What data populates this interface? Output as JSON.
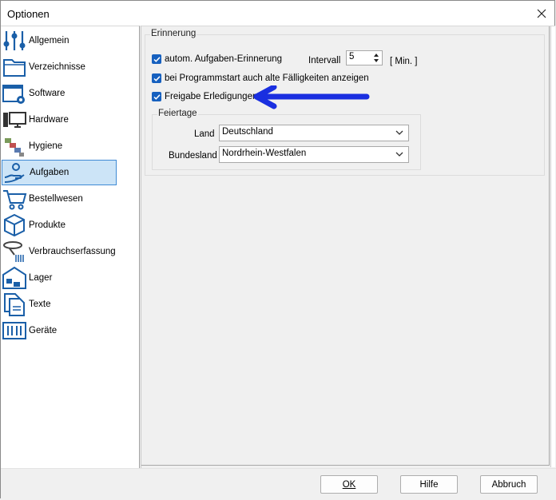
{
  "window": {
    "title": "Optionen"
  },
  "sidebar": {
    "items": [
      {
        "label": "Allgemein",
        "icon": "sliders-icon"
      },
      {
        "label": "Verzeichnisse",
        "icon": "folder-icon"
      },
      {
        "label": "Software",
        "icon": "window-gear-icon"
      },
      {
        "label": "Hardware",
        "icon": "computer-icon"
      },
      {
        "label": "Hygiene",
        "icon": "hygiene-icon"
      },
      {
        "label": "Aufgaben",
        "icon": "task-hand-icon",
        "selected": true
      },
      {
        "label": "Bestellwesen",
        "icon": "cart-icon"
      },
      {
        "label": "Produkte",
        "icon": "box-icon"
      },
      {
        "label": "Verbrauchserfassung",
        "icon": "scanner-icon"
      },
      {
        "label": "Lager",
        "icon": "warehouse-icon"
      },
      {
        "label": "Texte",
        "icon": "documents-icon"
      },
      {
        "label": "Geräte",
        "icon": "devices-icon"
      }
    ]
  },
  "erinnerung": {
    "title": "Erinnerung",
    "auto_label": "autom. Aufgaben-Erinnerung",
    "auto_checked": true,
    "intervall_label": "Intervall",
    "intervall_value": "5",
    "intervall_unit": "[ Min. ]",
    "startup_label": "bei Programmstart auch alte Fälligkeiten anzeigen",
    "startup_checked": true,
    "freigabe_label": "Freigabe Erledigungen",
    "freigabe_checked": true
  },
  "feiertage": {
    "title": "Feiertage",
    "land_label": "Land",
    "land_value": "Deutschland",
    "bundesland_label": "Bundesland",
    "bundesland_value": "Nordrhein-Westfalen"
  },
  "footer": {
    "ok_label": "OK",
    "hilfe_label": "Hilfe",
    "abbruch_label": "Abbruch"
  },
  "colors": {
    "accent": "#1660bf",
    "selection_bg": "#cce4f7",
    "annotation_arrow": "#1a2fe0"
  }
}
